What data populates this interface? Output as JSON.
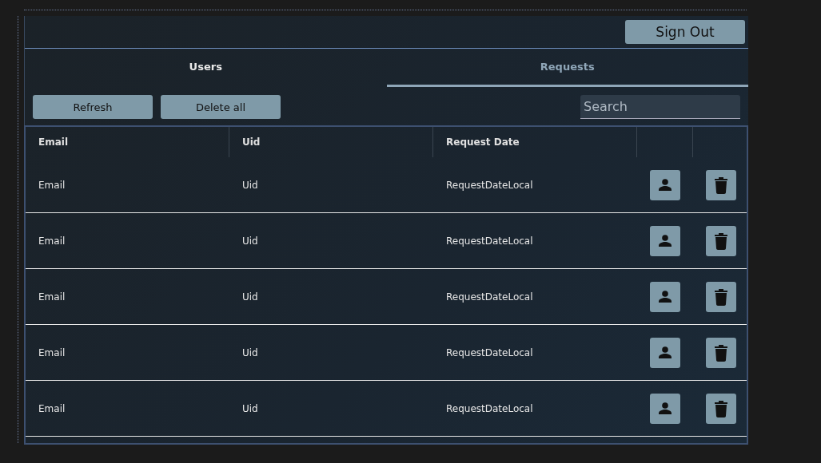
{
  "header": {
    "sign_out": "Sign Out"
  },
  "tabs": [
    {
      "label": "Users",
      "selected": false
    },
    {
      "label": "Requests",
      "selected": true
    }
  ],
  "toolbar": {
    "buttons": [
      "Refresh",
      "Delete all"
    ],
    "search": {
      "placeholder": "Search"
    }
  },
  "table": {
    "columns": [
      "Email",
      "Uid",
      "Request Date"
    ],
    "rows": [
      {
        "email": "Email",
        "uid": "Uid",
        "request_date": "RequestDateLocal"
      },
      {
        "email": "Email",
        "uid": "Uid",
        "request_date": "RequestDateLocal"
      },
      {
        "email": "Email",
        "uid": "Uid",
        "request_date": "RequestDateLocal"
      },
      {
        "email": "Email",
        "uid": "Uid",
        "request_date": "RequestDateLocal"
      },
      {
        "email": "Email",
        "uid": "Uid",
        "request_date": "RequestDateLocal"
      }
    ]
  }
}
